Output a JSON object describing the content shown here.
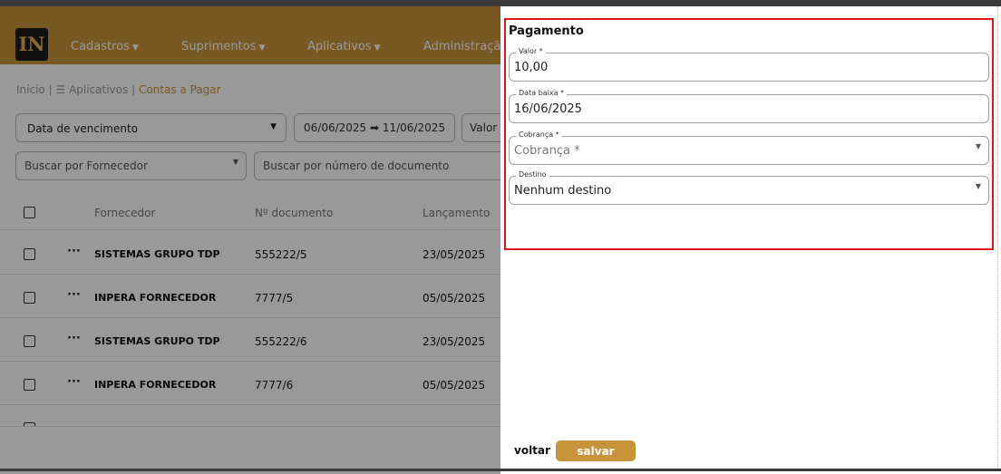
{
  "navbar": {
    "logo_text": "IN",
    "items": [
      {
        "label": "Cadastros"
      },
      {
        "label": "Suprimentos"
      },
      {
        "label": "Aplicativos"
      },
      {
        "label": "Administração"
      }
    ],
    "color": "#c8943a"
  },
  "breadcrumb": {
    "home": "Início",
    "sep1": "|",
    "apps": "Aplicativos",
    "sep2": "|",
    "current": "Contas a Pagar"
  },
  "filters": {
    "date_type": "Data de vencimento",
    "date_range": "06/06/2025 ➡ 11/06/2025",
    "valor": "Valor l",
    "supplier_placeholder": "Buscar por Fornecedor",
    "document_placeholder": "Buscar por número de documento"
  },
  "table": {
    "columns": [
      "Fornecedor",
      "Nº documento",
      "Lançamento"
    ],
    "rows": [
      {
        "fornecedor": "SISTEMAS GRUPO TDP",
        "documento": "555222/5",
        "lancamento": "23/05/2025"
      },
      {
        "fornecedor": "INPERA FORNECEDOR",
        "documento": "7777/5",
        "lancamento": "05/05/2025"
      },
      {
        "fornecedor": "SISTEMAS GRUPO TDP",
        "documento": "555222/6",
        "lancamento": "23/05/2025"
      },
      {
        "fornecedor": "INPERA FORNECEDOR",
        "documento": "7777/6",
        "lancamento": "05/05/2025"
      }
    ],
    "row_menu": "···"
  },
  "panel": {
    "title": "Pagamento",
    "fields": {
      "valor": {
        "label": "Valor *",
        "value": "10,00"
      },
      "data_baixa": {
        "label": "Data baixa *",
        "value": "16/06/2025"
      },
      "cobranca": {
        "label": "Cobrança *",
        "value": "Cobrança *"
      },
      "destino": {
        "label": "Destino",
        "value": "Nenhum destino"
      }
    },
    "back_label": "voltar",
    "save_label": "salvar",
    "highlight_color": "#e0161d"
  }
}
